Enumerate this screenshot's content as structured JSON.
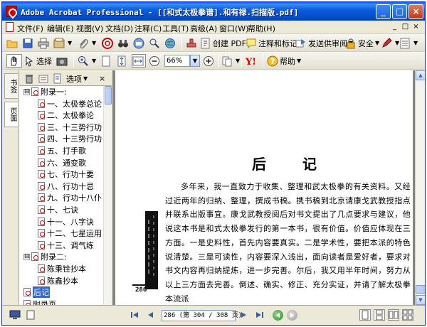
{
  "window": {
    "title": "Adobe Acrobat Professional - [[和式太极拳谱].和有禄.扫描版.pdf]",
    "buttons": [
      "_",
      "□",
      "×"
    ]
  },
  "menubar": {
    "items": [
      "文件(F)",
      "编辑(E)",
      "视图(V)",
      "文档(D)",
      "注释(C)",
      "工具(T)",
      "高级(A)",
      "窗口(W)",
      "帮助(H)"
    ],
    "controls": [
      "_",
      "□",
      "×"
    ]
  },
  "toolbar1": {
    "create_pdf": "创建 PDF",
    "comment": "注释和标记",
    "send_review": "发送供审阅",
    "security": "安全"
  },
  "toolbar2": {
    "select": "选择",
    "zoom_value": "66%",
    "help": "帮助"
  },
  "nav_tabs": [
    "书签",
    "页面"
  ],
  "bookmarks_panel": {
    "options_label": "选项",
    "close": "×",
    "items": [
      {
        "label": "附录一:",
        "level": 0,
        "expander": "⊟"
      },
      {
        "label": "一、太极拳总论",
        "level": 1
      },
      {
        "label": "二、太极拳论",
        "level": 1
      },
      {
        "label": "三、十三势行功",
        "level": 1
      },
      {
        "label": "四、十三势行功",
        "level": 1
      },
      {
        "label": "五、打手歌",
        "level": 1
      },
      {
        "label": "六、通变歌",
        "level": 1
      },
      {
        "label": "七、行功十要",
        "level": 1
      },
      {
        "label": "八、行功十忌",
        "level": 1
      },
      {
        "label": "九、行功十八仆",
        "level": 1
      },
      {
        "label": "十、七诀",
        "level": 1
      },
      {
        "label": "十一、八字诀",
        "level": 1
      },
      {
        "label": "十二、七星运用",
        "level": 1
      },
      {
        "label": "十三、调气练",
        "level": 1
      },
      {
        "label": "附录二:",
        "level": 0,
        "expander": "⊟"
      },
      {
        "label": "陈秉铨抄本",
        "level": 1
      },
      {
        "label": "陈鑫抄本",
        "level": 1
      },
      {
        "label": "后记",
        "level": 0,
        "selected": true
      },
      {
        "label": "附录页",
        "level": 0
      }
    ]
  },
  "document": {
    "title": "后 记",
    "paragraph": "多年来，我一直致力于收集、整理和武太极拳的有关资料。又经过近两年的归纳、整理，撰成书稿。携书稿到北京请康戈武教授指点并联系出版事宜。康戈武教授阅后对书文提出了几点要求与建议，他说这本书是和式太极拳发行的第一本书，很有价值。价值应体现在三方面。一是史料性，首先内容要真实。二是学术性，要把本派的特色说清楚。三是可读性，内容要深入浅出，面向读者是爱好者，要求对书文内容再归纳提炼，进一步完善。尔后，我又用半年时间，努力从以上三方面去完善。倒述、确实、修正、充分实证，并请了解太极拳本流派",
    "scan_page_number": "286"
  },
  "statusbar": {
    "page_field": "286 (第 304 / 308 页)"
  }
}
